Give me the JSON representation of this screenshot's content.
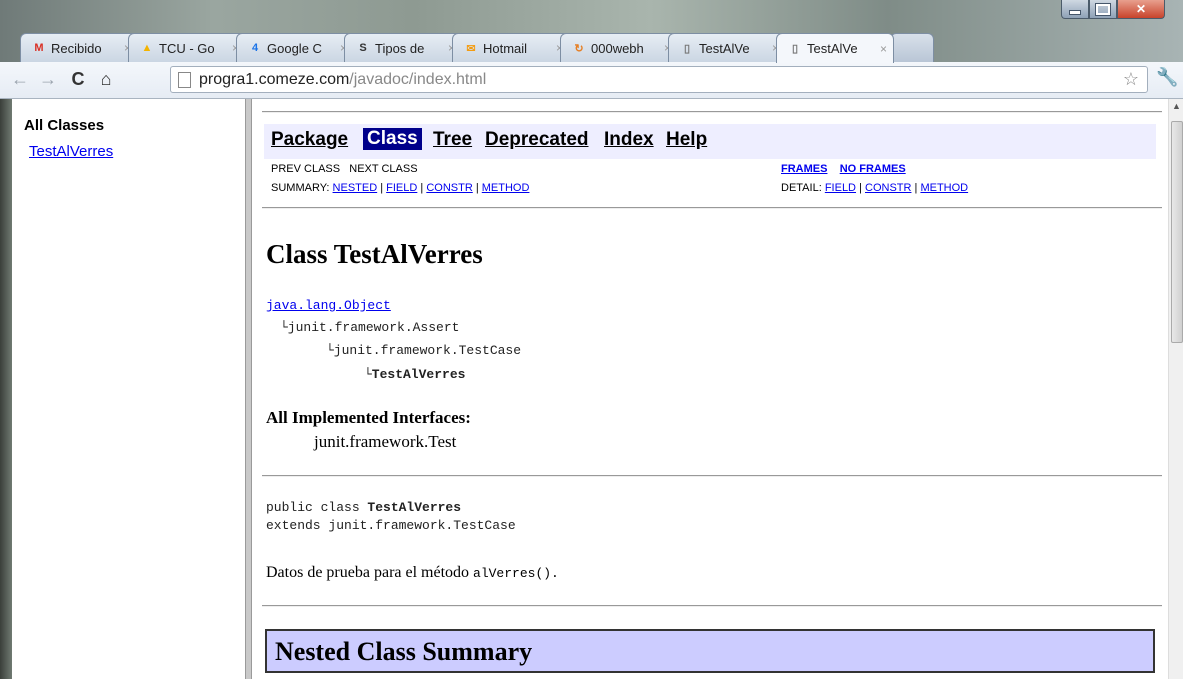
{
  "browser": {
    "tabs": [
      {
        "label": "Recibido",
        "icon": "gmail-icon",
        "icon_glyph": "M",
        "icon_color": "#d93025",
        "active": false
      },
      {
        "label": "TCU - Go",
        "icon": "drive-icon",
        "icon_glyph": "▲",
        "icon_color": "#f4b400",
        "active": false
      },
      {
        "label": "Google C",
        "icon": "calendar-icon",
        "icon_glyph": "4",
        "icon_color": "#1a73e8",
        "active": false
      },
      {
        "label": "Tipos de",
        "icon": "scribd-icon",
        "icon_glyph": "S",
        "icon_color": "#333333",
        "active": false
      },
      {
        "label": "Hotmail",
        "icon": "hotmail-icon",
        "icon_glyph": "✉",
        "icon_color": "#f39c12",
        "active": false
      },
      {
        "label": "000webh",
        "icon": "loading-icon",
        "icon_glyph": "↻",
        "icon_color": "#e67e22",
        "active": false
      },
      {
        "label": "TestAlVe",
        "icon": "page-icon",
        "icon_glyph": "▯",
        "icon_color": "#777777",
        "active": false
      },
      {
        "label": "TestAlVe",
        "icon": "page-icon",
        "icon_glyph": "▯",
        "icon_color": "#777777",
        "active": true
      }
    ],
    "url_host": "progra1.comeze.com",
    "url_path": "/javadoc/index.html"
  },
  "sidebar": {
    "heading": "All Classes",
    "link": "TestAlVerres"
  },
  "navbar": {
    "package": "Package",
    "class": "Class",
    "tree": "Tree",
    "deprecated": "Deprecated",
    "index": "Index",
    "help": "Help"
  },
  "subnav": {
    "prev_class": "PREV CLASS",
    "next_class": "NEXT CLASS",
    "frames": "FRAMES",
    "no_frames": "NO FRAMES",
    "summary_label": "SUMMARY:",
    "summary_nested": "NESTED",
    "summary_field": "FIELD",
    "summary_constr": "CONSTR",
    "summary_method": "METHOD",
    "detail_label": "DETAIL:",
    "detail_field": "FIELD",
    "detail_constr": "CONSTR",
    "detail_method": "METHOD",
    "sep": " | "
  },
  "classdoc": {
    "title": "Class TestAlVerres",
    "hierarchy": {
      "root": "java.lang.Object",
      "l1": "└junit.framework.Assert",
      "l2": "└junit.framework.TestCase",
      "l3": "└TestAlVerres"
    },
    "interfaces_heading": "All Implemented Interfaces:",
    "interfaces_value": "junit.framework.Test",
    "decl_line1_prefix": "public class ",
    "decl_line1_name": "TestAlVerres",
    "decl_line2": "extends junit.framework.TestCase",
    "description_text": "Datos de prueba para el método ",
    "description_code": "alVerres().",
    "nested_summary": "Nested Class Summary"
  }
}
